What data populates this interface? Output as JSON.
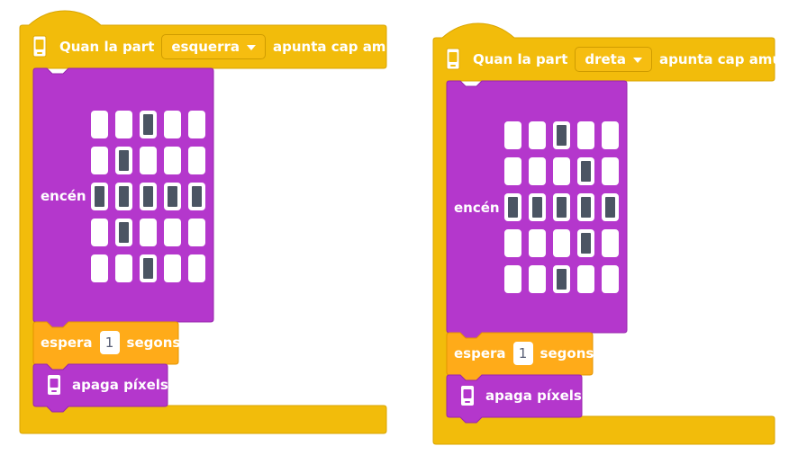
{
  "colors": {
    "hat_block": "#F2BC0B",
    "hat_block_border": "#D9A500",
    "display_block": "#B437CC",
    "display_block_border": "#9725AD",
    "wait_block": "#FFAB19",
    "wait_block_border": "#E39400",
    "led_on": "#4B5563",
    "led_off": "#FFFFFF"
  },
  "icons": {
    "hat": "microbit-tilt-icon",
    "clear": "microbit-display-icon"
  },
  "scripts": [
    {
      "hat": {
        "prefix": "Quan la part",
        "direction": "esquerra",
        "suffix": "apunta cap amunt"
      },
      "display": {
        "label": "encén",
        "matrix": [
          [
            0,
            0,
            1,
            0,
            0
          ],
          [
            0,
            1,
            0,
            0,
            0
          ],
          [
            1,
            1,
            1,
            1,
            1
          ],
          [
            0,
            1,
            0,
            0,
            0
          ],
          [
            0,
            0,
            1,
            0,
            0
          ]
        ]
      },
      "wait": {
        "prefix": "espera",
        "value": "1",
        "suffix": "segons"
      },
      "clear": {
        "label": "apaga píxels"
      }
    },
    {
      "hat": {
        "prefix": "Quan la part",
        "direction": "dreta",
        "suffix": "apunta cap amunt"
      },
      "display": {
        "label": "encén",
        "matrix": [
          [
            0,
            0,
            1,
            0,
            0
          ],
          [
            0,
            0,
            0,
            1,
            0
          ],
          [
            1,
            1,
            1,
            1,
            1
          ],
          [
            0,
            0,
            0,
            1,
            0
          ],
          [
            0,
            0,
            1,
            0,
            0
          ]
        ]
      },
      "wait": {
        "prefix": "espera",
        "value": "1",
        "suffix": "segons"
      },
      "clear": {
        "label": "apaga píxels"
      }
    }
  ]
}
